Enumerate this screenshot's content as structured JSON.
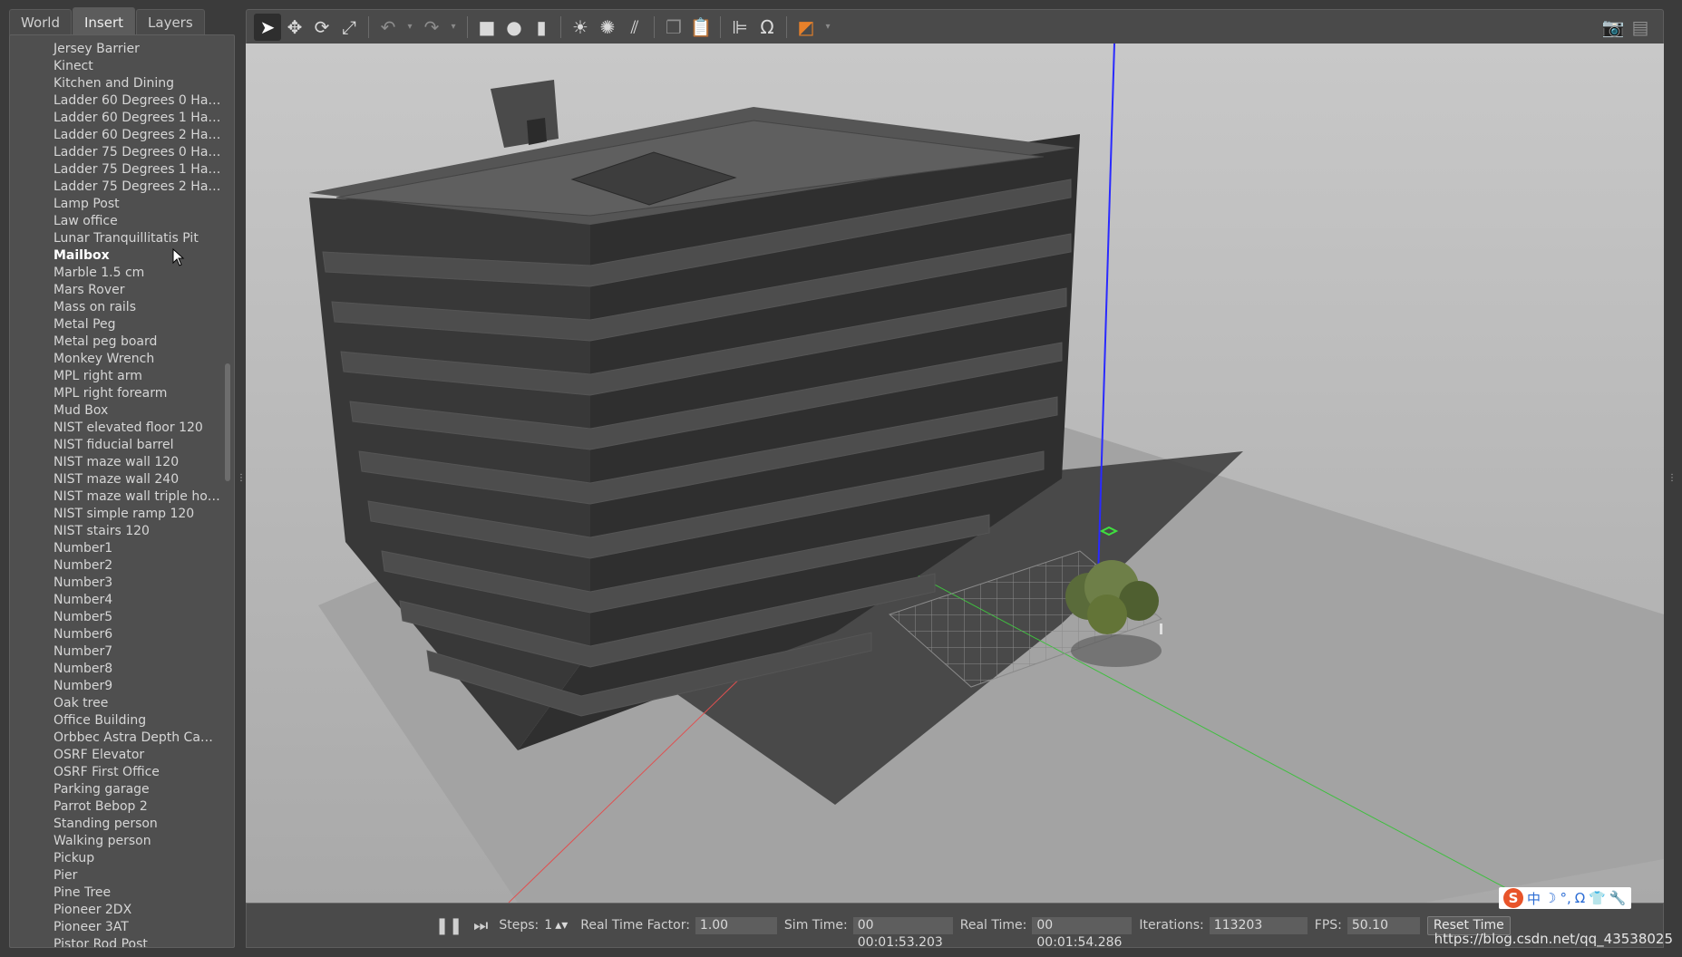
{
  "tabs": [
    {
      "label": "World"
    },
    {
      "label": "Insert"
    },
    {
      "label": "Layers"
    }
  ],
  "model_list": [
    "Jersey Barrier",
    "Kinect",
    "Kitchen and Dining",
    "Ladder 60 Degrees 0 Ha…",
    "Ladder 60 Degrees 1 Ha…",
    "Ladder 60 Degrees 2 Ha…",
    "Ladder 75 Degrees 0 Ha…",
    "Ladder 75 Degrees 1 Ha…",
    "Ladder 75 Degrees 2 Ha…",
    "Lamp Post",
    "Law office",
    "Lunar Tranquillitatis Pit",
    "Mailbox",
    "Marble 1.5 cm",
    "Mars Rover",
    "Mass on rails",
    "Metal Peg",
    "Metal peg board",
    "Monkey Wrench",
    "MPL right arm",
    "MPL right forearm",
    "Mud Box",
    "NIST elevated floor 120",
    "NIST fiducial barrel",
    "NIST maze wall 120",
    "NIST maze wall 240",
    "NIST maze wall triple ho…",
    "NIST simple ramp 120",
    "NIST stairs 120",
    "Number1",
    "Number2",
    "Number3",
    "Number4",
    "Number5",
    "Number6",
    "Number7",
    "Number8",
    "Number9",
    "Oak tree",
    "Office Building",
    "Orbbec Astra Depth Ca…",
    "OSRF Elevator",
    "OSRF First Office",
    "Parking garage",
    "Parrot Bebop 2",
    "Standing person",
    "Walking person",
    "Pickup",
    "Pier",
    "Pine Tree",
    "Pioneer 2DX",
    "Pioneer 3AT",
    "Pistor Rod Post"
  ],
  "hovered_item": "Mailbox",
  "bottom_bar": {
    "steps_label": "Steps:",
    "steps_value": "1",
    "rtf_label": "Real Time Factor:",
    "rtf_value": "1.00",
    "sim_time_label": "Sim Time:",
    "sim_time_value": "00 00:01:53.203",
    "real_time_label": "Real Time:",
    "real_time_value": "00 00:01:54.286",
    "iterations_label": "Iterations:",
    "iterations_value": "113203",
    "fps_label": "FPS:",
    "fps_value": "50.10",
    "reset_label": "Reset Time"
  },
  "ime_bar": {
    "logo": "S",
    "items": [
      "中",
      "☽",
      "°,",
      "Ω",
      "👕",
      "🔧"
    ]
  },
  "watermark": "https://blog.csdn.net/qq_43538025",
  "colors": {
    "accent_orange": "#e8812a",
    "x_axis": "#e05050",
    "y_axis": "#3fbf3f",
    "z_axis": "#2a2aff"
  }
}
